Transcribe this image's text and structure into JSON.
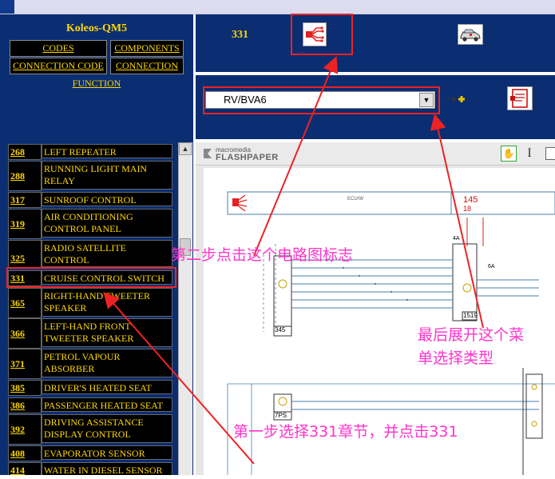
{
  "app_title": "Koleos-QM5",
  "nav": {
    "codes": "CODES",
    "components": "COMPONENTS",
    "connection_code": "CONNECTION CODE",
    "connection": "CONNECTION",
    "function": "FUNCTION"
  },
  "chapters": [
    {
      "num": "268",
      "label": "LEFT REPEATER"
    },
    {
      "num": "288",
      "label": "RUNNING LIGHT MAIN RELAY"
    },
    {
      "num": "317",
      "label": "SUNROOF CONTROL"
    },
    {
      "num": "319",
      "label": "AIR CONDITIONING CONTROL PANEL"
    },
    {
      "num": "325",
      "label": "RADIO SATELLITE CONTROL"
    },
    {
      "num": "331",
      "label": "CRUISE CONTROL SWITCH"
    },
    {
      "num": "365",
      "label": "RIGHT-HAND TWEETER SPEAKER"
    },
    {
      "num": "366",
      "label": "LEFT-HAND FRONT TWEETER SPEAKER"
    },
    {
      "num": "371",
      "label": "PETROL VAPOUR ABSORBER"
    },
    {
      "num": "385",
      "label": "DRIVER'S HEATED SEAT"
    },
    {
      "num": "386",
      "label": "PASSENGER HEATED SEAT"
    },
    {
      "num": "392",
      "label": "DRIVING ASSISTANCE DISPLAY CONTROL"
    },
    {
      "num": "408",
      "label": "EVAPORATOR SENSOR"
    },
    {
      "num": "414",
      "label": "WATER IN DIESEL SENSOR"
    }
  ],
  "selected_chapter": "331",
  "variant_select": {
    "value": "RV/BVA6"
  },
  "viewer": {
    "logo_top": "macromedia",
    "logo_bottom": "FLASHPAPER"
  },
  "diagram": {
    "ref_top": "145",
    "ref_small": "18",
    "box_label": "ECU/W",
    "conn1": "345",
    "conn2": "1519",
    "conn3": "7PS",
    "code1": "4A",
    "code2": "6A"
  },
  "annotations": {
    "step2": "第二步点击这个电路图标志",
    "last_line1": "最后展开这个菜",
    "last_line2": "单选择类型",
    "step1": "第一步选择331章节，并点击331"
  },
  "colors": {
    "panel": "#0b2d72",
    "accent": "#ffd800",
    "annotation": "#ff33cc",
    "highlight": "#ee2222"
  },
  "icons": [
    "circuit-diagram-icon",
    "car-icon",
    "add-variant-icon",
    "document-icon",
    "hand-tool-icon",
    "text-select-icon"
  ]
}
